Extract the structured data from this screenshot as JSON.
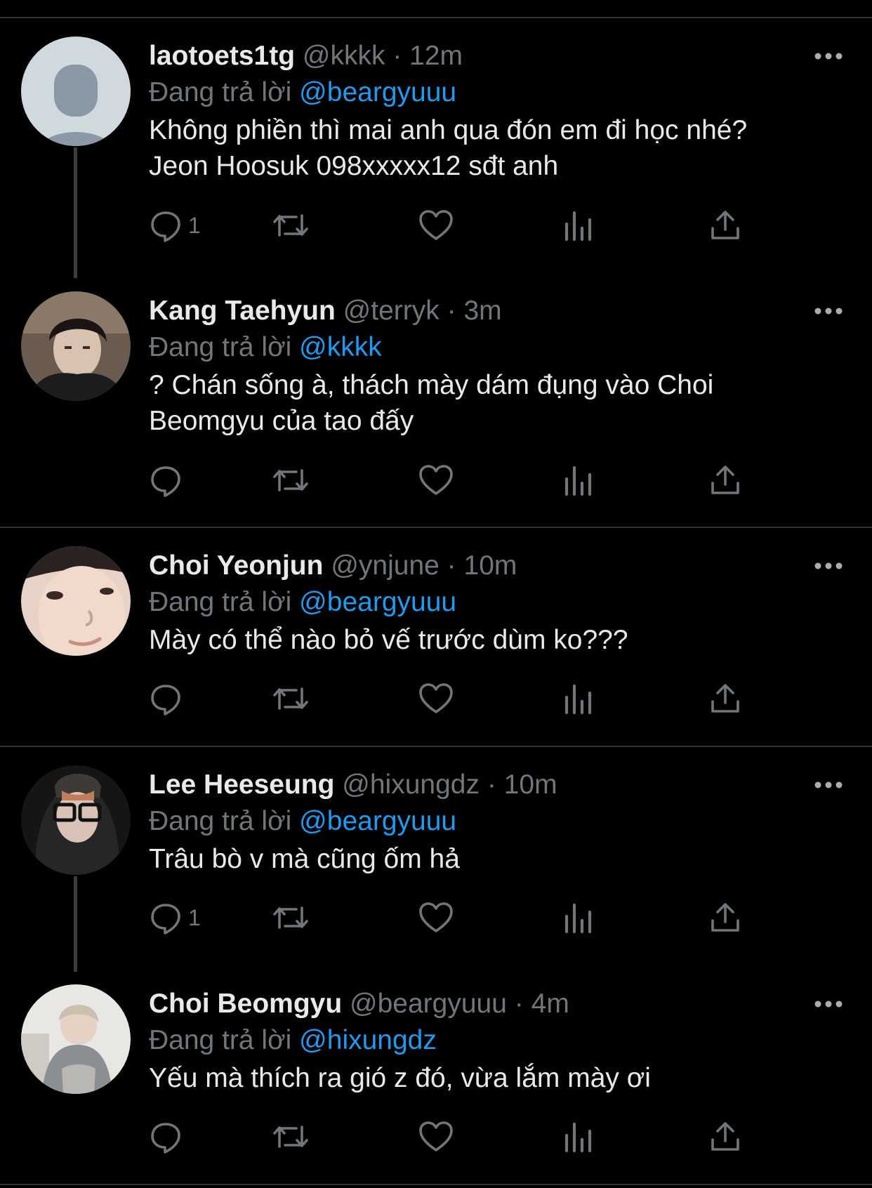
{
  "reply_label": "Đang trả lời",
  "icons": {
    "reply": "speech-bubble-icon",
    "retweet": "retweet-icon",
    "like": "heart-icon",
    "views": "bar-chart-icon",
    "share": "share-icon",
    "more": "more-dots-icon"
  },
  "colors": {
    "background": "#000000",
    "text": "#e7e9ea",
    "secondary": "#71767b",
    "accent": "#1d9bf0",
    "divider": "#2f3336"
  },
  "tweets": [
    {
      "name": "laotoets1tg",
      "handle": "@kkkk",
      "separator": "·",
      "time": "12m",
      "mention": "@beargyuuu",
      "text_lines": [
        "Không phiền thì mai anh qua đón em đi học nhé?",
        "Jeon Hoosuk 098xxxxx12 sđt anh"
      ],
      "reply_count": "1"
    },
    {
      "name": "Kang Taehyun",
      "handle": "@terryk",
      "separator": "·",
      "time": "3m",
      "mention": "@kkkk",
      "text_lines": [
        "? Chán sống à, thách mày dám đụng vào Choi",
        "Beomgyu của tao đấy"
      ],
      "reply_count": ""
    },
    {
      "name": "Choi Yeonjun",
      "handle": "@ynjune",
      "separator": "·",
      "time": "10m",
      "mention": "@beargyuuu",
      "text_lines": [
        "Mày có thể nào bỏ vế trước dùm ko???"
      ],
      "reply_count": ""
    },
    {
      "name": "Lee Heeseung",
      "handle": "@hixungdz",
      "separator": "·",
      "time": "10m",
      "mention": "@beargyuuu",
      "text_lines": [
        "Trâu bò v mà cũng ốm hả"
      ],
      "reply_count": "1"
    },
    {
      "name": "Choi Beomgyu",
      "handle": "@beargyuuu",
      "separator": "·",
      "time": "4m",
      "mention": "@hixungdz",
      "text_lines": [
        "Yếu mà thích ra gió z đó, vừa lắm mày ơi"
      ],
      "reply_count": ""
    }
  ]
}
